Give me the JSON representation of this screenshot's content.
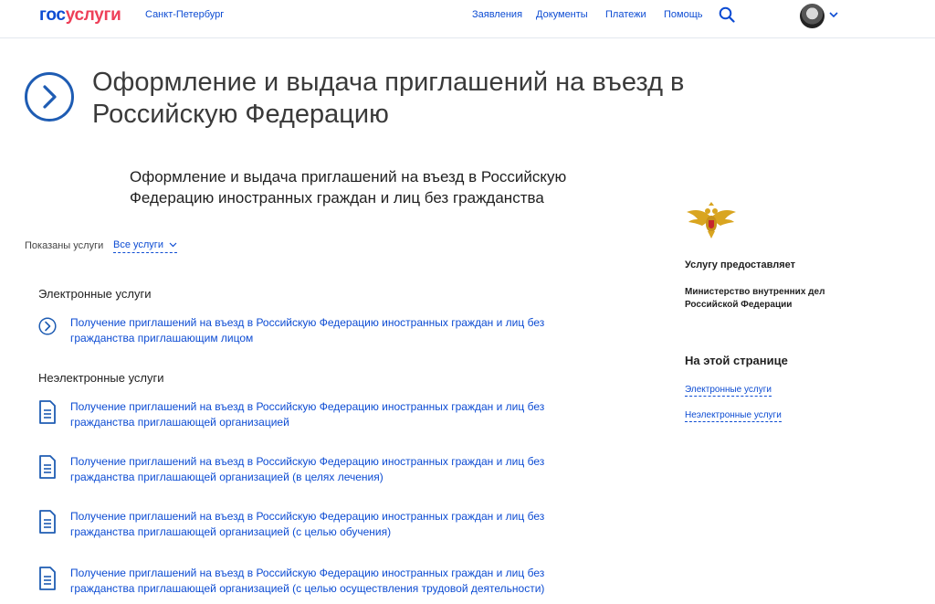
{
  "header": {
    "logo_part1": "гос",
    "logo_part2": "услуги",
    "region": "Санкт-Петербург",
    "nav": [
      "Заявления",
      "Документы",
      "Платежи",
      "Помощь"
    ]
  },
  "page": {
    "title": "Оформление и выдача приглашений на въезд в Российскую Федерацию",
    "subtitle": "Оформление и выдача приглашений на въезд в Российскую Федерацию иностранных граждан и лиц без гражданства"
  },
  "filter": {
    "label": "Показаны услуги",
    "value": "Все услуги"
  },
  "sections": {
    "electronic": {
      "heading": "Электронные услуги",
      "items": [
        "Получение приглашений на въезд в Российскую Федерацию иностранных граждан и лиц без гражданства приглашающим лицом"
      ]
    },
    "non_electronic": {
      "heading": "Неэлектронные услуги",
      "items": [
        "Получение приглашений на въезд в Российскую Федерацию иностранных граждан и лиц без гражданства приглашающей организацией",
        "Получение приглашений на въезд в Российскую Федерацию иностранных граждан и лиц без гражданства приглашающей организацией (в целях лечения)",
        "Получение приглашений на въезд в Российскую Федерацию иностранных граждан и лиц без гражданства приглашающей организацией (с целью обучения)",
        "Получение приглашений на въезд в Российскую Федерацию иностранных граждан и лиц без гражданства приглашающей организацией (с целью осуществления трудовой деятельности)"
      ]
    }
  },
  "sidebar": {
    "provider_label": "Услугу предоставляет",
    "provider_name": "Министерство внутренних дел Российской Федерации",
    "on_page_heading": "На этой странице",
    "anchors": [
      "Электронные услуги",
      "Неэлектронные услуги"
    ]
  },
  "colors": {
    "link": "#0d4cd3",
    "brand_red": "#ee3f58",
    "icon_blue": "#1e5cb3"
  }
}
